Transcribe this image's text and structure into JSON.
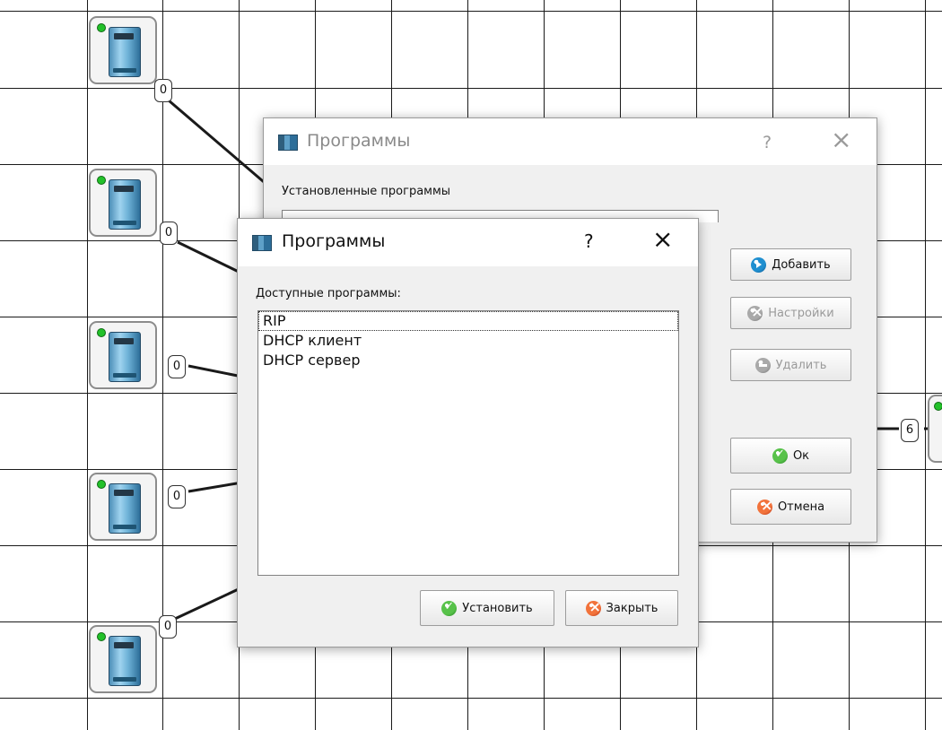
{
  "canvas": {
    "ports": [
      {
        "label": "0"
      },
      {
        "label": "0"
      },
      {
        "label": "0"
      },
      {
        "label": "0"
      },
      {
        "label": "0"
      },
      {
        "label": "6"
      }
    ]
  },
  "back_dialog": {
    "title": "Программы",
    "help": "?",
    "close": "×",
    "section_label": "Установленные программы",
    "buttons": {
      "add": "Добавить",
      "settings": "Настройки",
      "delete": "Удалить",
      "ok": "Ок",
      "cancel": "Отмена"
    }
  },
  "front_dialog": {
    "title": "Программы",
    "help": "?",
    "close": "×",
    "section_label": "Доступные программы:",
    "programs": [
      "RIP",
      "DHCP клиент",
      "DHCP сервер"
    ],
    "buttons": {
      "install": "Установить",
      "close": "Закрыть"
    }
  },
  "colors": {
    "dialog_bg": "#f0f0f0",
    "status_led": "#23c12a",
    "grid": "#1a1a1a"
  }
}
